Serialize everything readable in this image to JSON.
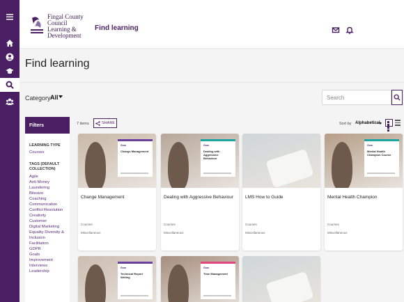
{
  "rail": {
    "icons": [
      "menu-icon",
      "home-icon",
      "profile-icon",
      "graduation-icon",
      "search-icon",
      "team-icon"
    ],
    "active": "search-icon"
  },
  "header": {
    "logo_lines": [
      "Fingal County",
      "Council",
      "Learning &",
      "Development"
    ],
    "app_title": "Find learning",
    "icons": [
      "mail-icon",
      "bell-icon"
    ]
  },
  "page": {
    "title": "Find learning"
  },
  "category": {
    "label": "Category",
    "value": "All",
    "search_placeholder": "Search"
  },
  "filters": {
    "heading": "Filters",
    "sections": [
      {
        "title": "LEARNING TYPE",
        "items": [
          "Courses"
        ]
      },
      {
        "title": "TAGS (DEFAULT COLLECTION)",
        "items": [
          "Agile",
          "Anti Money Laundering",
          "Bitesize",
          "Coaching",
          "Communication",
          "Conflict Resolution",
          "Creativity",
          "Customer",
          "Digital Marketing",
          "Equality Diversity & Inclusion",
          "Facilitation",
          "GDPR",
          "Goals",
          "Improvement",
          "Interviews",
          "Leadership"
        ]
      }
    ]
  },
  "toolbar": {
    "items_count": "7 items",
    "share_label": "SHARE",
    "sort_label": "Sort by",
    "sort_value": "Alphabetical"
  },
  "cards": [
    {
      "title": "Change Management",
      "overlay_title": "Change Management",
      "brand": "Gom",
      "type": "Courses",
      "tag": "Miscellaneous",
      "accent": "#6b3fa0",
      "bg": "#c9b9a8"
    },
    {
      "title": "Dealing with Aggressive Behaviour",
      "overlay_title": "Dealing with Aggressive Behaviour",
      "brand": "Gom",
      "type": "Courses",
      "tag": "Miscellaneous",
      "accent": "#1aa5a0",
      "bg": "#b7a79a"
    },
    {
      "title": "LMS How to Guide",
      "overlay_title": "",
      "brand": "",
      "type": "Courses",
      "tag": "Miscellaneous",
      "accent": "#ffffff",
      "bg": "#cfd6d8"
    },
    {
      "title": "Mental Health Champion",
      "overlay_title": "Mental Health Champion Course",
      "brand": "Gom",
      "type": "Courses",
      "tag": "Miscellaneous",
      "accent": "#1aa5a0",
      "bg": "#b59e87"
    },
    {
      "title": "",
      "overlay_title": "Technical Report Writing",
      "brand": "Gom",
      "type": "",
      "tag": "",
      "accent": "#6b3fa0",
      "bg": "#cbbcaf"
    },
    {
      "title": "",
      "overlay_title": "Time Management",
      "brand": "Gom",
      "type": "",
      "tag": "",
      "accent": "#e0467c",
      "bg": "#a58e7e"
    },
    {
      "title": "",
      "overlay_title": "",
      "brand": "",
      "type": "",
      "tag": "",
      "accent": "#ffffff",
      "bg": "#cfd6d8"
    }
  ],
  "colors": {
    "brand": "#4a1e63",
    "background": "#f4f4f4"
  }
}
